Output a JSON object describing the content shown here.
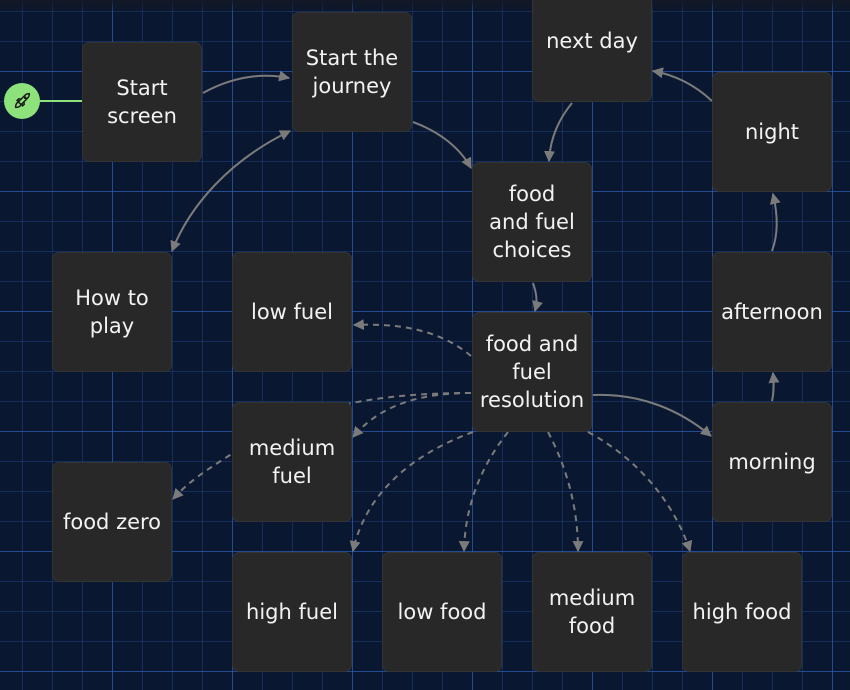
{
  "diagram": {
    "start_icon": "rocket-icon",
    "accent_color": "#8de27b",
    "nodes": [
      {
        "id": "start_screen",
        "label": "Start screen"
      },
      {
        "id": "start_journey",
        "label": "Start the journey"
      },
      {
        "id": "next_day",
        "label": "next day"
      },
      {
        "id": "night",
        "label": "night"
      },
      {
        "id": "how_to_play",
        "label": "How to play"
      },
      {
        "id": "low_fuel",
        "label": "low fuel"
      },
      {
        "id": "food_fuel_choices",
        "label": "food and fuel choices"
      },
      {
        "id": "food_fuel_resolution",
        "label": "food and fuel resolution"
      },
      {
        "id": "afternoon",
        "label": "afternoon"
      },
      {
        "id": "medium_fuel",
        "label": "medium fuel"
      },
      {
        "id": "morning",
        "label": "morning"
      },
      {
        "id": "food_zero",
        "label": "food zero"
      },
      {
        "id": "high_fuel",
        "label": "high fuel"
      },
      {
        "id": "low_food",
        "label": "low food"
      },
      {
        "id": "medium_food",
        "label": "medium food"
      },
      {
        "id": "high_food",
        "label": "high food"
      }
    ],
    "edges": [
      {
        "from": "start_screen",
        "to": "start_journey",
        "style": "solid"
      },
      {
        "from": "start_journey",
        "to": "how_to_play",
        "style": "solid",
        "bidirectional": true
      },
      {
        "from": "start_journey",
        "to": "food_fuel_choices",
        "style": "solid"
      },
      {
        "from": "next_day",
        "to": "food_fuel_choices",
        "style": "solid"
      },
      {
        "from": "night",
        "to": "next_day",
        "style": "solid"
      },
      {
        "from": "afternoon",
        "to": "night",
        "style": "solid"
      },
      {
        "from": "morning",
        "to": "afternoon",
        "style": "solid"
      },
      {
        "from": "food_fuel_choices",
        "to": "food_fuel_resolution",
        "style": "solid"
      },
      {
        "from": "food_fuel_resolution",
        "to": "morning",
        "style": "solid"
      },
      {
        "from": "food_fuel_resolution",
        "to": "low_fuel",
        "style": "dashed"
      },
      {
        "from": "food_fuel_resolution",
        "to": "medium_fuel",
        "style": "dashed"
      },
      {
        "from": "food_fuel_resolution",
        "to": "food_zero",
        "style": "dashed"
      },
      {
        "from": "food_fuel_resolution",
        "to": "high_fuel",
        "style": "dashed"
      },
      {
        "from": "food_fuel_resolution",
        "to": "low_food",
        "style": "dashed"
      },
      {
        "from": "food_fuel_resolution",
        "to": "medium_food",
        "style": "dashed"
      },
      {
        "from": "food_fuel_resolution",
        "to": "high_food",
        "style": "dashed"
      }
    ]
  }
}
